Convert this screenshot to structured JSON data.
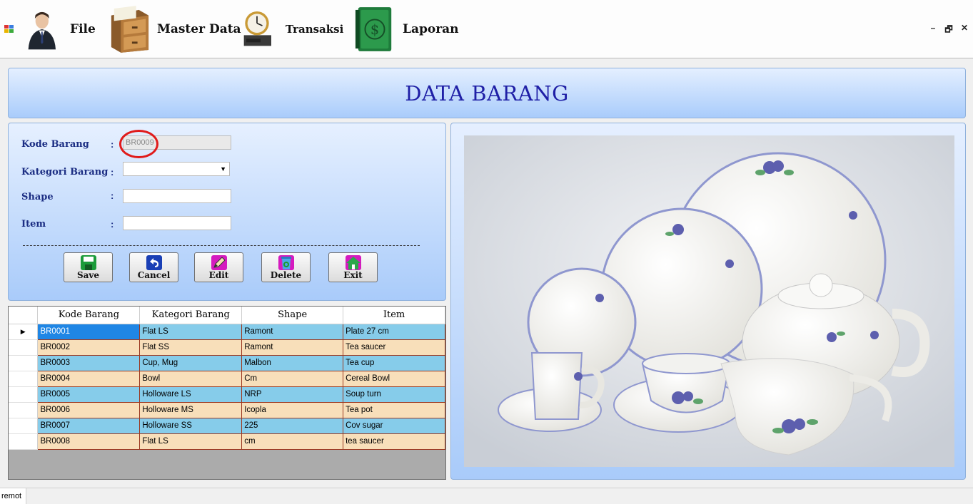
{
  "menu": {
    "items": [
      {
        "label": "File",
        "icon": "businessman-icon"
      },
      {
        "label": "Master Data",
        "icon": "filing-cabinet-icon"
      },
      {
        "label": "Transaksi",
        "icon": "clock-drive-icon"
      },
      {
        "label": "Laporan",
        "icon": "money-book-icon"
      }
    ],
    "window_controls": {
      "minimize": "–",
      "restore": "🗗",
      "close": "✕"
    }
  },
  "page": {
    "title": "DATA BARANG"
  },
  "form": {
    "colon": ":",
    "kode_barang": {
      "label": "Kode Barang",
      "value": "BR0009"
    },
    "kategori_barang": {
      "label": "Kategori Barang",
      "value": ""
    },
    "shape": {
      "label": "Shape",
      "value": ""
    },
    "item": {
      "label": "Item",
      "value": ""
    }
  },
  "buttons": {
    "save": "Save",
    "cancel": "Cancel",
    "edit": "Edit",
    "delete": "Delete",
    "exit": "Exit"
  },
  "grid": {
    "headers": [
      "Kode Barang",
      "Kategori Barang",
      "Shape",
      "Item"
    ],
    "rows": [
      [
        "BR0001",
        "Flat LS",
        "Ramont",
        "Plate 27 cm"
      ],
      [
        "BR0002",
        "Flat SS",
        "Ramont",
        "Tea saucer"
      ],
      [
        "BR0003",
        "Cup, Mug",
        "Malbon",
        "Tea cup"
      ],
      [
        "BR0004",
        "Bowl",
        "Cm",
        "Cereal Bowl"
      ],
      [
        "BR0005",
        "Holloware LS",
        "NRP",
        "Soup turn"
      ],
      [
        "BR0006",
        "Holloware MS",
        "Icopla",
        "Tea pot"
      ],
      [
        "BR0007",
        "Holloware SS",
        "225",
        "Cov sugar"
      ],
      [
        "BR0008",
        "Flat LS",
        "cm",
        "tea saucer"
      ]
    ],
    "current_row_marker": "▶"
  },
  "status": {
    "text": "remot"
  },
  "colors": {
    "title_text": "#1f1fa6",
    "label_text": "#1b2d83",
    "row_odd": "#86ccea",
    "row_even": "#f8dfba",
    "selected_cell": "#1f86e5",
    "highlight_circle": "#e01b1b"
  }
}
